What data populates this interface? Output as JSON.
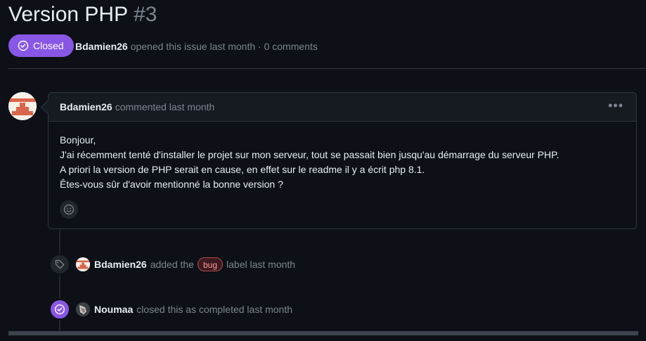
{
  "issue": {
    "title": "Version PHP",
    "number": "#3",
    "state_label": "Closed",
    "state_color": "#8957e5",
    "author": "Bdamien26",
    "opened_text": "opened this issue last month · 0 comments"
  },
  "comment": {
    "author": "Bdamien26",
    "meta": "commented last month",
    "menu_icon": "kebab-horizontal-icon",
    "lines": [
      "Bonjour,",
      "J'ai récemment tenté d'installer le projet sur mon serveur, tout se passait bien jusqu'au démarrage du serveur PHP.",
      "A priori la version de PHP serait en cause, en effet sur le readme il y a écrit php 8.1.",
      "Êtes-vous sûr d'avoir mentionné la bonne version ?"
    ],
    "reaction_icon": "smiley-icon"
  },
  "events": [
    {
      "icon": "tag-icon",
      "actor": "Bdamien26",
      "text_before": "added the",
      "label": "bug",
      "text_after": "label last month"
    },
    {
      "icon": "check-circle-icon",
      "actor": "Noumaa",
      "text": "closed this as completed last month"
    }
  ]
}
